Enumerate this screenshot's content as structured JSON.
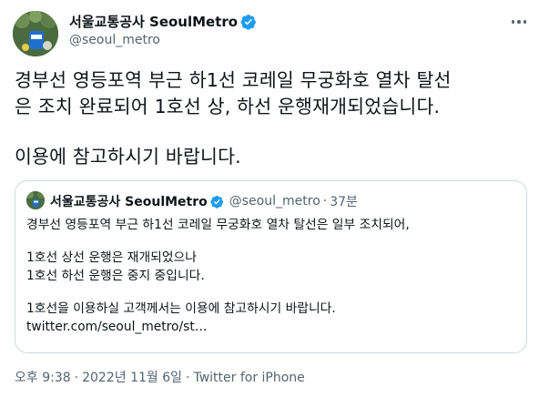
{
  "author": {
    "display_name": "서울교통공사 SeoulMetro",
    "handle": "@seoul_metro"
  },
  "tweet": {
    "lines": [
      "경부선 영등포역 부근 하1선 코레일 무궁화호 열차 탈선",
      "은 조치 완료되어 1호선 상, 하선 운행재개되었습니다.",
      "이용에 참고하시기 바랍니다."
    ]
  },
  "quoted": {
    "display_name": "서울교통공사 SeoulMetro",
    "handle": "@seoul_metro",
    "separator": "·",
    "time": "37분",
    "lines": [
      "경부선 영등포역 부근 하1선 코레일 무궁화호 열차 탈선은 일부 조치되어,",
      "1호선 상선 운행은 재개되었으나",
      "1호선 하선 운행은 중지 중입니다.",
      "1호선을 이용하실 고객께서는 이용에 참고하시기 바랍니다."
    ],
    "link": "twitter.com/seoul_metro/st…"
  },
  "footer": {
    "time": "오후 9:38",
    "separator": "·",
    "date": "2022년 11월 6일",
    "source": "Twitter for iPhone"
  },
  "colors": {
    "verified_badge": "#1d9bf0",
    "secondary_text": "#536471",
    "border": "#cfd9de"
  },
  "icons": {
    "verified": "verified-badge-icon",
    "more": "more-dots-icon"
  }
}
